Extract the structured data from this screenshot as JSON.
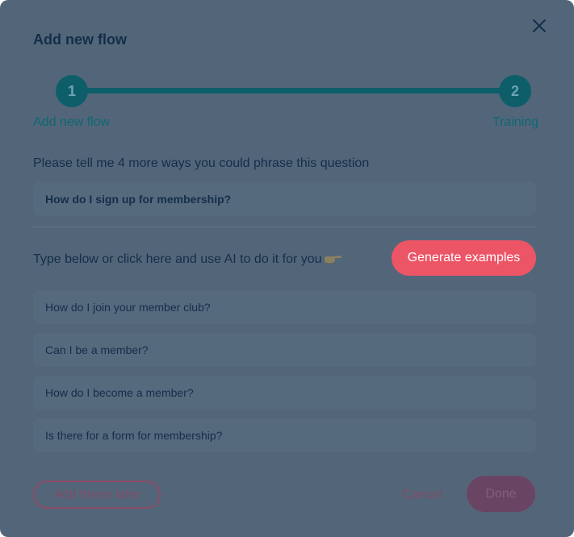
{
  "dialog": {
    "title": "Add new flow",
    "close_icon": "close-icon"
  },
  "stepper": {
    "steps": [
      {
        "number": "1",
        "label": "Add new flow"
      },
      {
        "number": "2",
        "label": "Training"
      }
    ],
    "current_step": 2
  },
  "question": {
    "prompt": "Please tell me 4 more ways you could phrase this question",
    "value": "How do I sign up for membership?"
  },
  "examples": {
    "prompt": "Type below or click here and use AI to do it for you",
    "pointing_icon": "pointing-hand-icon",
    "generate_label": "Generate examples",
    "items": [
      "How do I join your member club?",
      "Can I be a member?",
      "How do I become a member?",
      "Is there for a form for membership?"
    ]
  },
  "footer": {
    "later_label": "Add these later",
    "cancel_label": "Cancel",
    "done_label": "Done"
  },
  "colors": {
    "overlay": "#536679",
    "accent_teal": "#0e5e6a",
    "accent_pink": "#ec5566",
    "text_dark": "#142e4a"
  }
}
